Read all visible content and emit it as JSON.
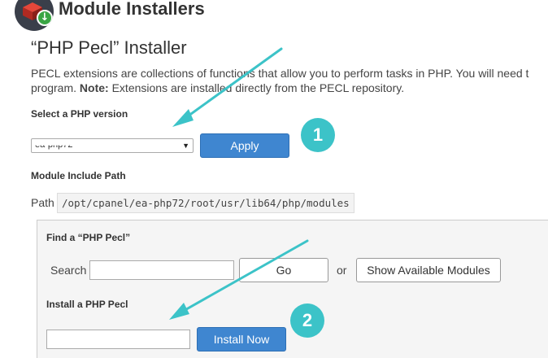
{
  "header": {
    "title": "Module Installers"
  },
  "installer": {
    "title": "“PHP Pecl” Installer",
    "description_line1": "PECL extensions are collections of functions that allow you to perform tasks in PHP. You will need t",
    "description_line2_prefix": "program. ",
    "note_label": "Note:",
    "description_line2_suffix": " Extensions are installed directly from the PECL repository."
  },
  "version": {
    "label": "Select a PHP version",
    "selected": "ea-php72",
    "apply_label": "Apply"
  },
  "include_path": {
    "label": "Module Include Path",
    "path_label": "Path",
    "value": "/opt/cpanel/ea-php72/root/usr/lib64/php/modules"
  },
  "find": {
    "label": "Find a “PHP Pecl”",
    "search_label": "Search",
    "search_value": "",
    "go_label": "Go",
    "or_label": "or",
    "show_modules_label": "Show Available Modules"
  },
  "install": {
    "label": "Install a PHP Pecl",
    "input_value": "",
    "button_label": "Install Now"
  },
  "annotations": {
    "badge1": "1",
    "badge2": "2",
    "color": "#3cc3c8"
  },
  "colors": {
    "primary_button": "#3f86d0",
    "panel_bg": "#f5f5f5"
  }
}
